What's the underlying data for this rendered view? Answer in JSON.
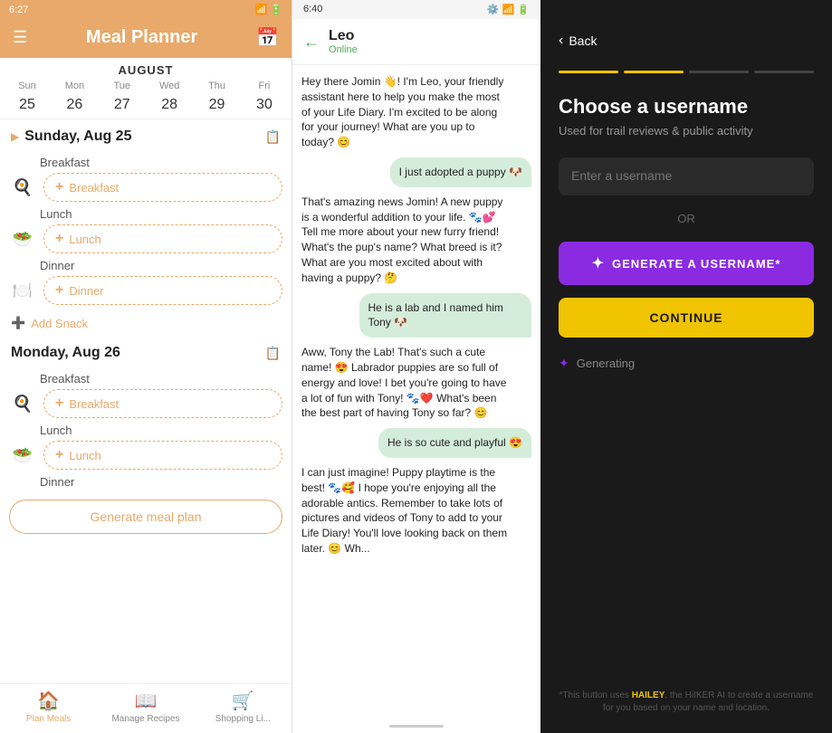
{
  "meal_planner": {
    "status_time": "6:27",
    "header_title": "Meal Planner",
    "calendar": {
      "month": "AUGUST",
      "days": [
        "Sun",
        "Mon",
        "Tue",
        "Wed",
        "Thu",
        "Fri"
      ],
      "dates": [
        "25",
        "26",
        "27",
        "28",
        "29",
        "30"
      ],
      "today_index": 0
    },
    "day1": {
      "label": "Sunday, Aug 25",
      "arrow": "▶",
      "meals": {
        "breakfast_label": "Breakfast",
        "breakfast_placeholder": "Breakfast",
        "lunch_label": "Lunch",
        "lunch_placeholder": "Lunch",
        "dinner_label": "Dinner",
        "dinner_placeholder": "Dinner"
      },
      "add_snack": "Add Snack"
    },
    "day2": {
      "label": "Monday, Aug 26",
      "meals": {
        "breakfast_label": "Breakfast",
        "breakfast_placeholder": "Breakfast",
        "lunch_label": "Lunch",
        "lunch_placeholder": "Lunch",
        "dinner_label": "Dinner"
      }
    },
    "generate_btn": "Generate meal plan",
    "nav": {
      "plan_meals": "Plan Meals",
      "manage_recipes": "Manage Recipes",
      "shopping_list": "Shopping Li..."
    },
    "icons": {
      "hamburger": "☰",
      "calendar": "📅",
      "breakfast_emoji": "🍽️",
      "lunch_emoji": "🥗",
      "dinner_emoji": "🍽️",
      "plus": "+"
    }
  },
  "chat": {
    "status_time": "6:40",
    "contact_name": "Leo",
    "contact_status": "Online",
    "back_arrow": "←",
    "messages": [
      {
        "side": "left",
        "text": "Hey there Jomin 👋! I'm Leo, your friendly assistant here to help you make the most of your Life Diary. I'm excited to be along for your journey! What are you up to today? 😊"
      },
      {
        "side": "right",
        "text": "I just adopted a puppy 🐶"
      },
      {
        "side": "left",
        "text": "That's amazing news Jomin! A new puppy is a wonderful addition to your life. 🐾💕 Tell me more about your new furry friend! What's the pup's name? What breed is it? What are you most excited about with having a puppy? 🤔"
      },
      {
        "side": "right",
        "text": "He is a lab and I named him Tony 🐶"
      },
      {
        "side": "left",
        "text": "Aww, Tony the Lab! That's such a cute name! 😍 Labrador puppies are so full of energy and love! I bet you're going to have a lot of fun with Tony! 🐾❤️ What's been the best part of having Tony so far? 😊"
      },
      {
        "side": "right",
        "text": "He is so cute and playful 😍"
      },
      {
        "side": "left",
        "text": "I can just imagine! Puppy playtime is the best! 🐾🥰 I hope you're enjoying all the adorable antics. Remember to take lots of pictures and videos of Tony to add to your Life Diary! You'll love looking back on them later. 😊 Wh..."
      }
    ]
  },
  "username": {
    "back_label": "Back",
    "dividers": [
      "active",
      "active",
      "inactive",
      "inactive"
    ],
    "title": "Choose a username",
    "subtitle": "Used for trail reviews & public activity",
    "input_placeholder": "Enter a username",
    "or_label": "OR",
    "generate_btn_label": "GENERATE A USERNAME*",
    "continue_btn_label": "CONTINUE",
    "generating_label": "Generating",
    "footer_text": "*This button uses HAILEY, the HiIKER AI to create a username for you based on your name and location."
  }
}
